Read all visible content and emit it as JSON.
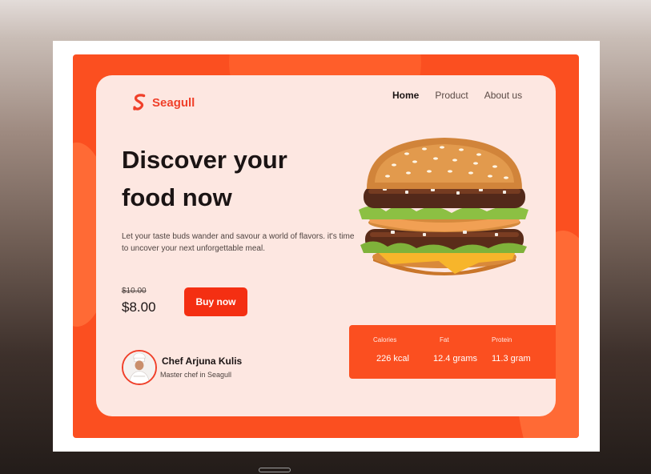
{
  "brand": {
    "name": "Seagull",
    "accent": "#f0402a",
    "board": "#fb4f20",
    "card": "#fde7e1"
  },
  "nav": {
    "items": [
      {
        "label": "Home",
        "active": true
      },
      {
        "label": "Product",
        "active": false
      },
      {
        "label": "About us",
        "active": false
      }
    ]
  },
  "hero": {
    "title": "Discover your food now",
    "description": "Let your taste buds wander and savour a world of flavors. it's time to uncover your next unforgettable meal."
  },
  "pricing": {
    "old_price": "$10.00",
    "new_price": "$8.00",
    "buy_label": "Buy now"
  },
  "nutrition": [
    {
      "label": "Calories",
      "value": "226 kcal"
    },
    {
      "label": "Fat",
      "value": "12.4 grams"
    },
    {
      "label": "Protein",
      "value": "11.3 gram"
    }
  ],
  "chef": {
    "name": "Chef Arjuna Kulis",
    "role": "Master chef in Seagull"
  },
  "icons": {
    "logo": "seagull-logo-icon",
    "product": "burger-image",
    "avatar": "chef-avatar"
  }
}
